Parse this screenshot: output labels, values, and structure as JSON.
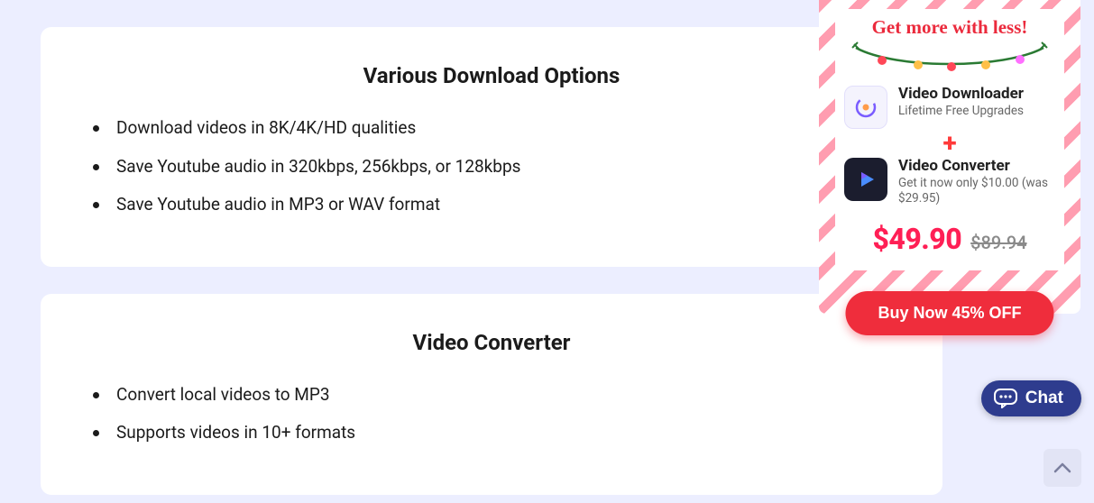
{
  "cards": [
    {
      "title": "Various Download Options",
      "items": [
        "Download videos in 8K/4K/HD qualities",
        "Save Youtube audio in 320kbps, 256kbps, or 128kbps",
        "Save Youtube audio in MP3 or WAV format"
      ]
    },
    {
      "title": "Video Converter",
      "items": [
        "Convert local videos to MP3",
        "Supports videos in 10+ formats"
      ]
    }
  ],
  "promo": {
    "headline": "Get more with less!",
    "products": [
      {
        "title": "Video Downloader",
        "sub": "Lifetime Free Upgrades"
      },
      {
        "title": "Video Converter",
        "sub": "Get it now only $10.00 (was $29.95)"
      }
    ],
    "plus": "+",
    "price_now": "$49.90",
    "price_was": "$89.94",
    "cta": "Buy Now 45% OFF"
  },
  "chat_label": "Chat"
}
